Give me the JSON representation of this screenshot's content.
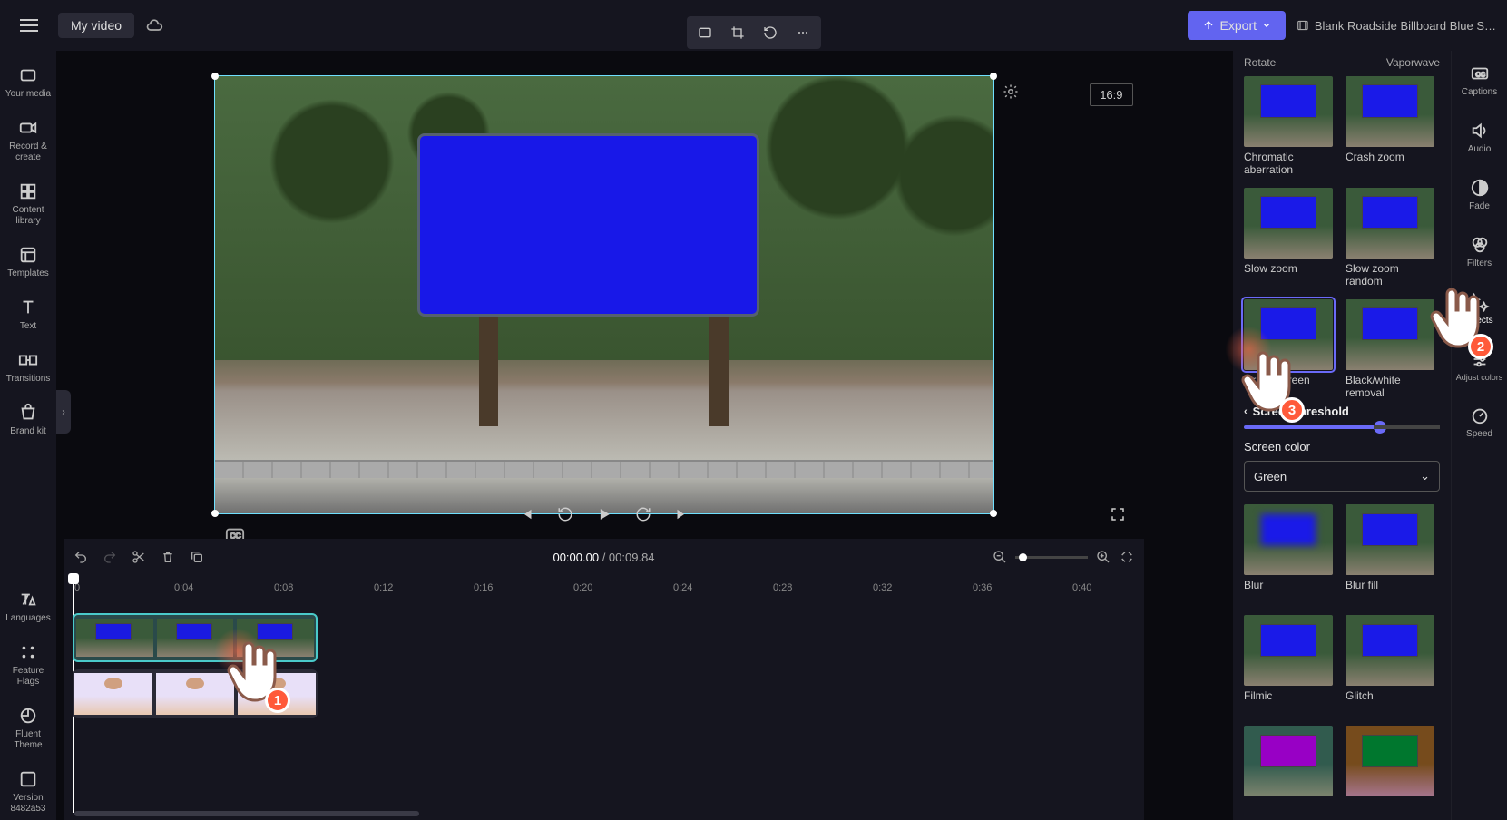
{
  "topbar": {
    "project_title": "My video",
    "export_label": "Export",
    "clip_title": "Blank Roadside Billboard Blue S…"
  },
  "leftbar": {
    "items": [
      {
        "label": "Your media",
        "icon": "media-icon"
      },
      {
        "label": "Record & create",
        "icon": "camera-icon"
      },
      {
        "label": "Content library",
        "icon": "library-icon"
      },
      {
        "label": "Templates",
        "icon": "templates-icon"
      },
      {
        "label": "Text",
        "icon": "text-icon"
      },
      {
        "label": "Transitions",
        "icon": "transitions-icon"
      },
      {
        "label": "Brand kit",
        "icon": "brandkit-icon"
      }
    ],
    "footer": [
      {
        "label": "Languages"
      },
      {
        "label": "Feature Flags"
      },
      {
        "label": "Fluent Theme"
      },
      {
        "label": "Version 8482a53"
      }
    ]
  },
  "canvas": {
    "aspect_label": "16:9"
  },
  "transport": {
    "current_time": "00:00.00",
    "separator": " / ",
    "total_time": "00:09.84"
  },
  "ruler": {
    "ticks": [
      "0",
      "0:04",
      "0:08",
      "0:12",
      "0:16",
      "0:20",
      "0:24",
      "0:28",
      "0:32",
      "0:36",
      "0:40"
    ]
  },
  "right_panel": {
    "top_row": [
      "Rotate",
      "Vaporwave"
    ],
    "effects": [
      {
        "label": "Chromatic aberration"
      },
      {
        "label": "Crash zoom"
      },
      {
        "label": "Slow zoom"
      },
      {
        "label": "Slow zoom random"
      },
      {
        "label": "Green screen",
        "selected": true
      },
      {
        "label": "Black/white removal"
      }
    ],
    "subsection_label": "Screen threshold",
    "screen_color_label": "Screen color",
    "screen_color_value": "Green",
    "effects2": [
      {
        "label": "Blur"
      },
      {
        "label": "Blur fill"
      },
      {
        "label": "Filmic"
      },
      {
        "label": "Glitch"
      }
    ]
  },
  "right_tabs": [
    {
      "label": "Captions",
      "icon": "captions-icon"
    },
    {
      "label": "Audio",
      "icon": "audio-icon"
    },
    {
      "label": "Fade",
      "icon": "fade-icon"
    },
    {
      "label": "Filters",
      "icon": "filters-icon"
    },
    {
      "label": "Effects",
      "icon": "effects-icon"
    },
    {
      "label": "Adjust colors",
      "icon": "adjust-icon"
    },
    {
      "label": "Speed",
      "icon": "speed-icon"
    }
  ],
  "coach_marks": {
    "one": "1",
    "two": "2",
    "three": "3"
  },
  "help_label": "?"
}
